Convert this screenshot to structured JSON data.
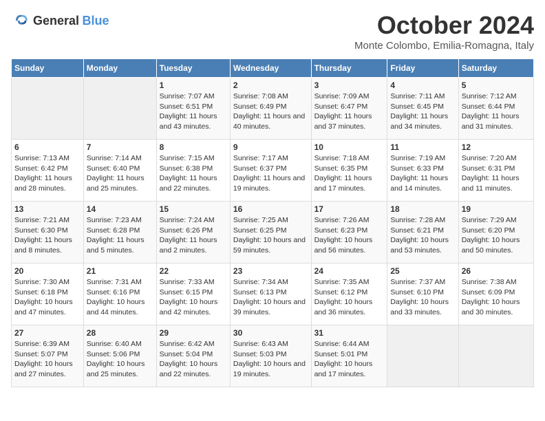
{
  "header": {
    "logo_general": "General",
    "logo_blue": "Blue",
    "month_title": "October 2024",
    "subtitle": "Monte Colombo, Emilia-Romagna, Italy"
  },
  "days_of_week": [
    "Sunday",
    "Monday",
    "Tuesday",
    "Wednesday",
    "Thursday",
    "Friday",
    "Saturday"
  ],
  "weeks": [
    [
      {
        "day": "",
        "sunrise": "",
        "sunset": "",
        "daylight": ""
      },
      {
        "day": "",
        "sunrise": "",
        "sunset": "",
        "daylight": ""
      },
      {
        "day": "1",
        "sunrise": "Sunrise: 7:07 AM",
        "sunset": "Sunset: 6:51 PM",
        "daylight": "Daylight: 11 hours and 43 minutes."
      },
      {
        "day": "2",
        "sunrise": "Sunrise: 7:08 AM",
        "sunset": "Sunset: 6:49 PM",
        "daylight": "Daylight: 11 hours and 40 minutes."
      },
      {
        "day": "3",
        "sunrise": "Sunrise: 7:09 AM",
        "sunset": "Sunset: 6:47 PM",
        "daylight": "Daylight: 11 hours and 37 minutes."
      },
      {
        "day": "4",
        "sunrise": "Sunrise: 7:11 AM",
        "sunset": "Sunset: 6:45 PM",
        "daylight": "Daylight: 11 hours and 34 minutes."
      },
      {
        "day": "5",
        "sunrise": "Sunrise: 7:12 AM",
        "sunset": "Sunset: 6:44 PM",
        "daylight": "Daylight: 11 hours and 31 minutes."
      }
    ],
    [
      {
        "day": "6",
        "sunrise": "Sunrise: 7:13 AM",
        "sunset": "Sunset: 6:42 PM",
        "daylight": "Daylight: 11 hours and 28 minutes."
      },
      {
        "day": "7",
        "sunrise": "Sunrise: 7:14 AM",
        "sunset": "Sunset: 6:40 PM",
        "daylight": "Daylight: 11 hours and 25 minutes."
      },
      {
        "day": "8",
        "sunrise": "Sunrise: 7:15 AM",
        "sunset": "Sunset: 6:38 PM",
        "daylight": "Daylight: 11 hours and 22 minutes."
      },
      {
        "day": "9",
        "sunrise": "Sunrise: 7:17 AM",
        "sunset": "Sunset: 6:37 PM",
        "daylight": "Daylight: 11 hours and 19 minutes."
      },
      {
        "day": "10",
        "sunrise": "Sunrise: 7:18 AM",
        "sunset": "Sunset: 6:35 PM",
        "daylight": "Daylight: 11 hours and 17 minutes."
      },
      {
        "day": "11",
        "sunrise": "Sunrise: 7:19 AM",
        "sunset": "Sunset: 6:33 PM",
        "daylight": "Daylight: 11 hours and 14 minutes."
      },
      {
        "day": "12",
        "sunrise": "Sunrise: 7:20 AM",
        "sunset": "Sunset: 6:31 PM",
        "daylight": "Daylight: 11 hours and 11 minutes."
      }
    ],
    [
      {
        "day": "13",
        "sunrise": "Sunrise: 7:21 AM",
        "sunset": "Sunset: 6:30 PM",
        "daylight": "Daylight: 11 hours and 8 minutes."
      },
      {
        "day": "14",
        "sunrise": "Sunrise: 7:23 AM",
        "sunset": "Sunset: 6:28 PM",
        "daylight": "Daylight: 11 hours and 5 minutes."
      },
      {
        "day": "15",
        "sunrise": "Sunrise: 7:24 AM",
        "sunset": "Sunset: 6:26 PM",
        "daylight": "Daylight: 11 hours and 2 minutes."
      },
      {
        "day": "16",
        "sunrise": "Sunrise: 7:25 AM",
        "sunset": "Sunset: 6:25 PM",
        "daylight": "Daylight: 10 hours and 59 minutes."
      },
      {
        "day": "17",
        "sunrise": "Sunrise: 7:26 AM",
        "sunset": "Sunset: 6:23 PM",
        "daylight": "Daylight: 10 hours and 56 minutes."
      },
      {
        "day": "18",
        "sunrise": "Sunrise: 7:28 AM",
        "sunset": "Sunset: 6:21 PM",
        "daylight": "Daylight: 10 hours and 53 minutes."
      },
      {
        "day": "19",
        "sunrise": "Sunrise: 7:29 AM",
        "sunset": "Sunset: 6:20 PM",
        "daylight": "Daylight: 10 hours and 50 minutes."
      }
    ],
    [
      {
        "day": "20",
        "sunrise": "Sunrise: 7:30 AM",
        "sunset": "Sunset: 6:18 PM",
        "daylight": "Daylight: 10 hours and 47 minutes."
      },
      {
        "day": "21",
        "sunrise": "Sunrise: 7:31 AM",
        "sunset": "Sunset: 6:16 PM",
        "daylight": "Daylight: 10 hours and 44 minutes."
      },
      {
        "day": "22",
        "sunrise": "Sunrise: 7:33 AM",
        "sunset": "Sunset: 6:15 PM",
        "daylight": "Daylight: 10 hours and 42 minutes."
      },
      {
        "day": "23",
        "sunrise": "Sunrise: 7:34 AM",
        "sunset": "Sunset: 6:13 PM",
        "daylight": "Daylight: 10 hours and 39 minutes."
      },
      {
        "day": "24",
        "sunrise": "Sunrise: 7:35 AM",
        "sunset": "Sunset: 6:12 PM",
        "daylight": "Daylight: 10 hours and 36 minutes."
      },
      {
        "day": "25",
        "sunrise": "Sunrise: 7:37 AM",
        "sunset": "Sunset: 6:10 PM",
        "daylight": "Daylight: 10 hours and 33 minutes."
      },
      {
        "day": "26",
        "sunrise": "Sunrise: 7:38 AM",
        "sunset": "Sunset: 6:09 PM",
        "daylight": "Daylight: 10 hours and 30 minutes."
      }
    ],
    [
      {
        "day": "27",
        "sunrise": "Sunrise: 6:39 AM",
        "sunset": "Sunset: 5:07 PM",
        "daylight": "Daylight: 10 hours and 27 minutes."
      },
      {
        "day": "28",
        "sunrise": "Sunrise: 6:40 AM",
        "sunset": "Sunset: 5:06 PM",
        "daylight": "Daylight: 10 hours and 25 minutes."
      },
      {
        "day": "29",
        "sunrise": "Sunrise: 6:42 AM",
        "sunset": "Sunset: 5:04 PM",
        "daylight": "Daylight: 10 hours and 22 minutes."
      },
      {
        "day": "30",
        "sunrise": "Sunrise: 6:43 AM",
        "sunset": "Sunset: 5:03 PM",
        "daylight": "Daylight: 10 hours and 19 minutes."
      },
      {
        "day": "31",
        "sunrise": "Sunrise: 6:44 AM",
        "sunset": "Sunset: 5:01 PM",
        "daylight": "Daylight: 10 hours and 17 minutes."
      },
      {
        "day": "",
        "sunrise": "",
        "sunset": "",
        "daylight": ""
      },
      {
        "day": "",
        "sunrise": "",
        "sunset": "",
        "daylight": ""
      }
    ]
  ]
}
